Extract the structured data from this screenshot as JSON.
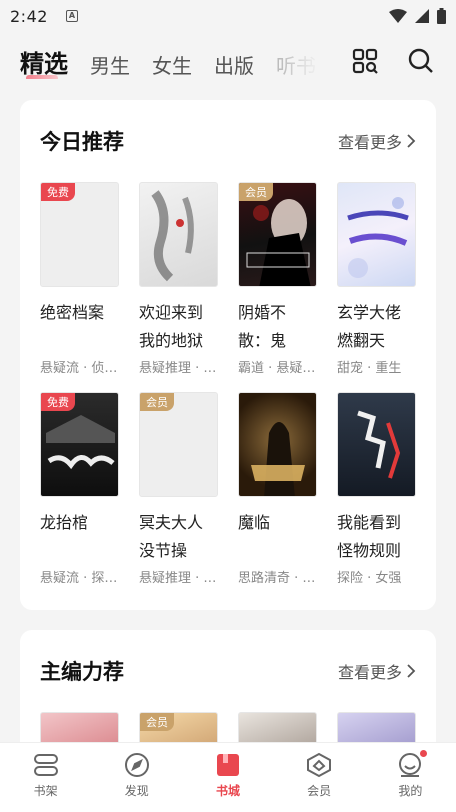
{
  "status": {
    "time": "2:42",
    "notif": "A"
  },
  "tabs": [
    {
      "label": "精选",
      "active": true
    },
    {
      "label": "男生"
    },
    {
      "label": "女生"
    },
    {
      "label": "出版"
    },
    {
      "label": "听书"
    }
  ],
  "today": {
    "title": "今日推荐",
    "more": "查看更多",
    "books": [
      {
        "title": "绝密档案",
        "meta": "悬疑流 · 侦…",
        "badge": "免费"
      },
      {
        "title": "欢迎来到我的地狱",
        "meta": "悬疑推理 · …",
        "badge": ""
      },
      {
        "title": "阴婚不散：鬼夫…",
        "meta": "霸道 · 悬疑…",
        "badge": "会员"
      },
      {
        "title": "玄学大佬燃翻天",
        "meta": "甜宠 · 重生",
        "badge": ""
      },
      {
        "title": "龙抬棺",
        "meta": "悬疑流 · 探…",
        "badge": "免费"
      },
      {
        "title": "冥夫大人没节操",
        "meta": "悬疑推理 · …",
        "badge": "会员"
      },
      {
        "title": "魔临",
        "meta": "思路清奇 · …",
        "badge": ""
      },
      {
        "title": "我能看到怪物规则",
        "meta": "探险 · 女强",
        "badge": ""
      }
    ]
  },
  "editor": {
    "title": "主编力荐",
    "more": "查看更多",
    "books": [
      {
        "badge": ""
      },
      {
        "badge": "会员"
      },
      {
        "badge": ""
      },
      {
        "badge": ""
      }
    ]
  },
  "bottom_nav": [
    {
      "label": "书架",
      "icon": "bookshelf-icon"
    },
    {
      "label": "发现",
      "icon": "compass-icon"
    },
    {
      "label": "书城",
      "icon": "bookstore-icon",
      "active": true
    },
    {
      "label": "会员",
      "icon": "vip-icon"
    },
    {
      "label": "我的",
      "icon": "profile-icon"
    }
  ],
  "colors": {
    "accent": "#e9474f",
    "vip": "#c9a26a"
  }
}
